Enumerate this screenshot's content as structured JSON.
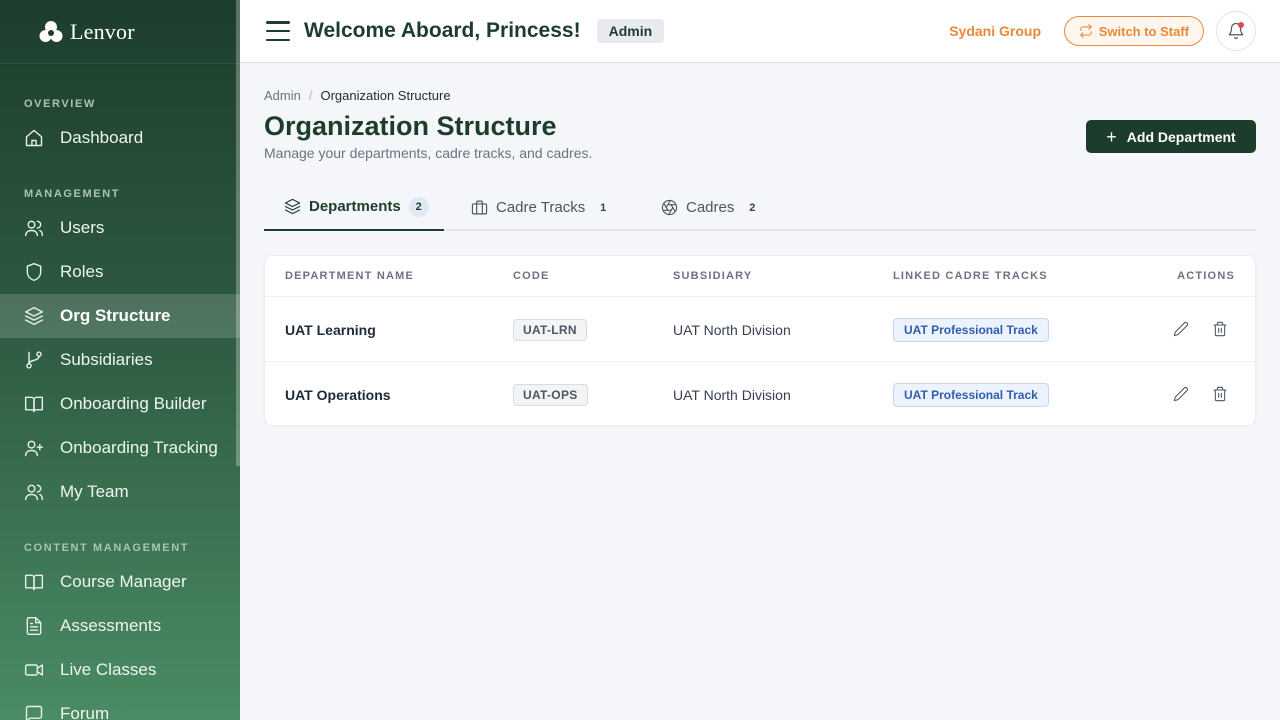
{
  "brand": {
    "name": "Lenvor"
  },
  "sidebar": {
    "sections": {
      "overview": "OVERVIEW",
      "management": "MANAGEMENT",
      "content": "CONTENT MANAGEMENT"
    },
    "items": [
      {
        "label": "Dashboard",
        "icon": "home-icon"
      },
      {
        "label": "Users",
        "icon": "users-icon"
      },
      {
        "label": "Roles",
        "icon": "shield-icon"
      },
      {
        "label": "Org Structure",
        "icon": "layers-icon",
        "active": true
      },
      {
        "label": "Subsidiaries",
        "icon": "git-branch-icon"
      },
      {
        "label": "Onboarding Builder",
        "icon": "book-open-icon"
      },
      {
        "label": "Onboarding Tracking",
        "icon": "user-plus-icon"
      },
      {
        "label": "My Team",
        "icon": "users-icon"
      },
      {
        "label": "Course Manager",
        "icon": "book-open-icon"
      },
      {
        "label": "Assessments",
        "icon": "file-text-icon"
      },
      {
        "label": "Live Classes",
        "icon": "video-icon"
      },
      {
        "label": "Forum",
        "icon": "message-square-icon"
      }
    ]
  },
  "header": {
    "welcome": "Welcome Aboard, Princess!",
    "role_badge": "Admin",
    "org_name": "Sydani Group",
    "switch_label": "Switch to Staff",
    "accent_color": "#e8893a"
  },
  "breadcrumb": {
    "root": "Admin",
    "separator": "/",
    "current": "Organization Structure"
  },
  "page": {
    "title": "Organization Structure",
    "subtitle": "Manage your departments, cadre tracks, and cadres.",
    "add_button": "Add Department",
    "brand_color": "#1d3d2c"
  },
  "tabs": [
    {
      "label": "Departments",
      "count": "2",
      "icon": "layers-icon",
      "active": true
    },
    {
      "label": "Cadre Tracks",
      "count": "1",
      "icon": "briefcase-icon"
    },
    {
      "label": "Cadres",
      "count": "2",
      "icon": "aperture-icon"
    }
  ],
  "table": {
    "columns": [
      "DEPARTMENT NAME",
      "CODE",
      "SUBSIDIARY",
      "LINKED CADRE TRACKS",
      "ACTIONS"
    ],
    "rows": [
      {
        "name": "UAT Learning",
        "code": "UAT-LRN",
        "subsidiary": "UAT North Division",
        "track": "UAT Professional Track"
      },
      {
        "name": "UAT Operations",
        "code": "UAT-OPS",
        "subsidiary": "UAT North Division",
        "track": "UAT Professional Track"
      }
    ]
  }
}
